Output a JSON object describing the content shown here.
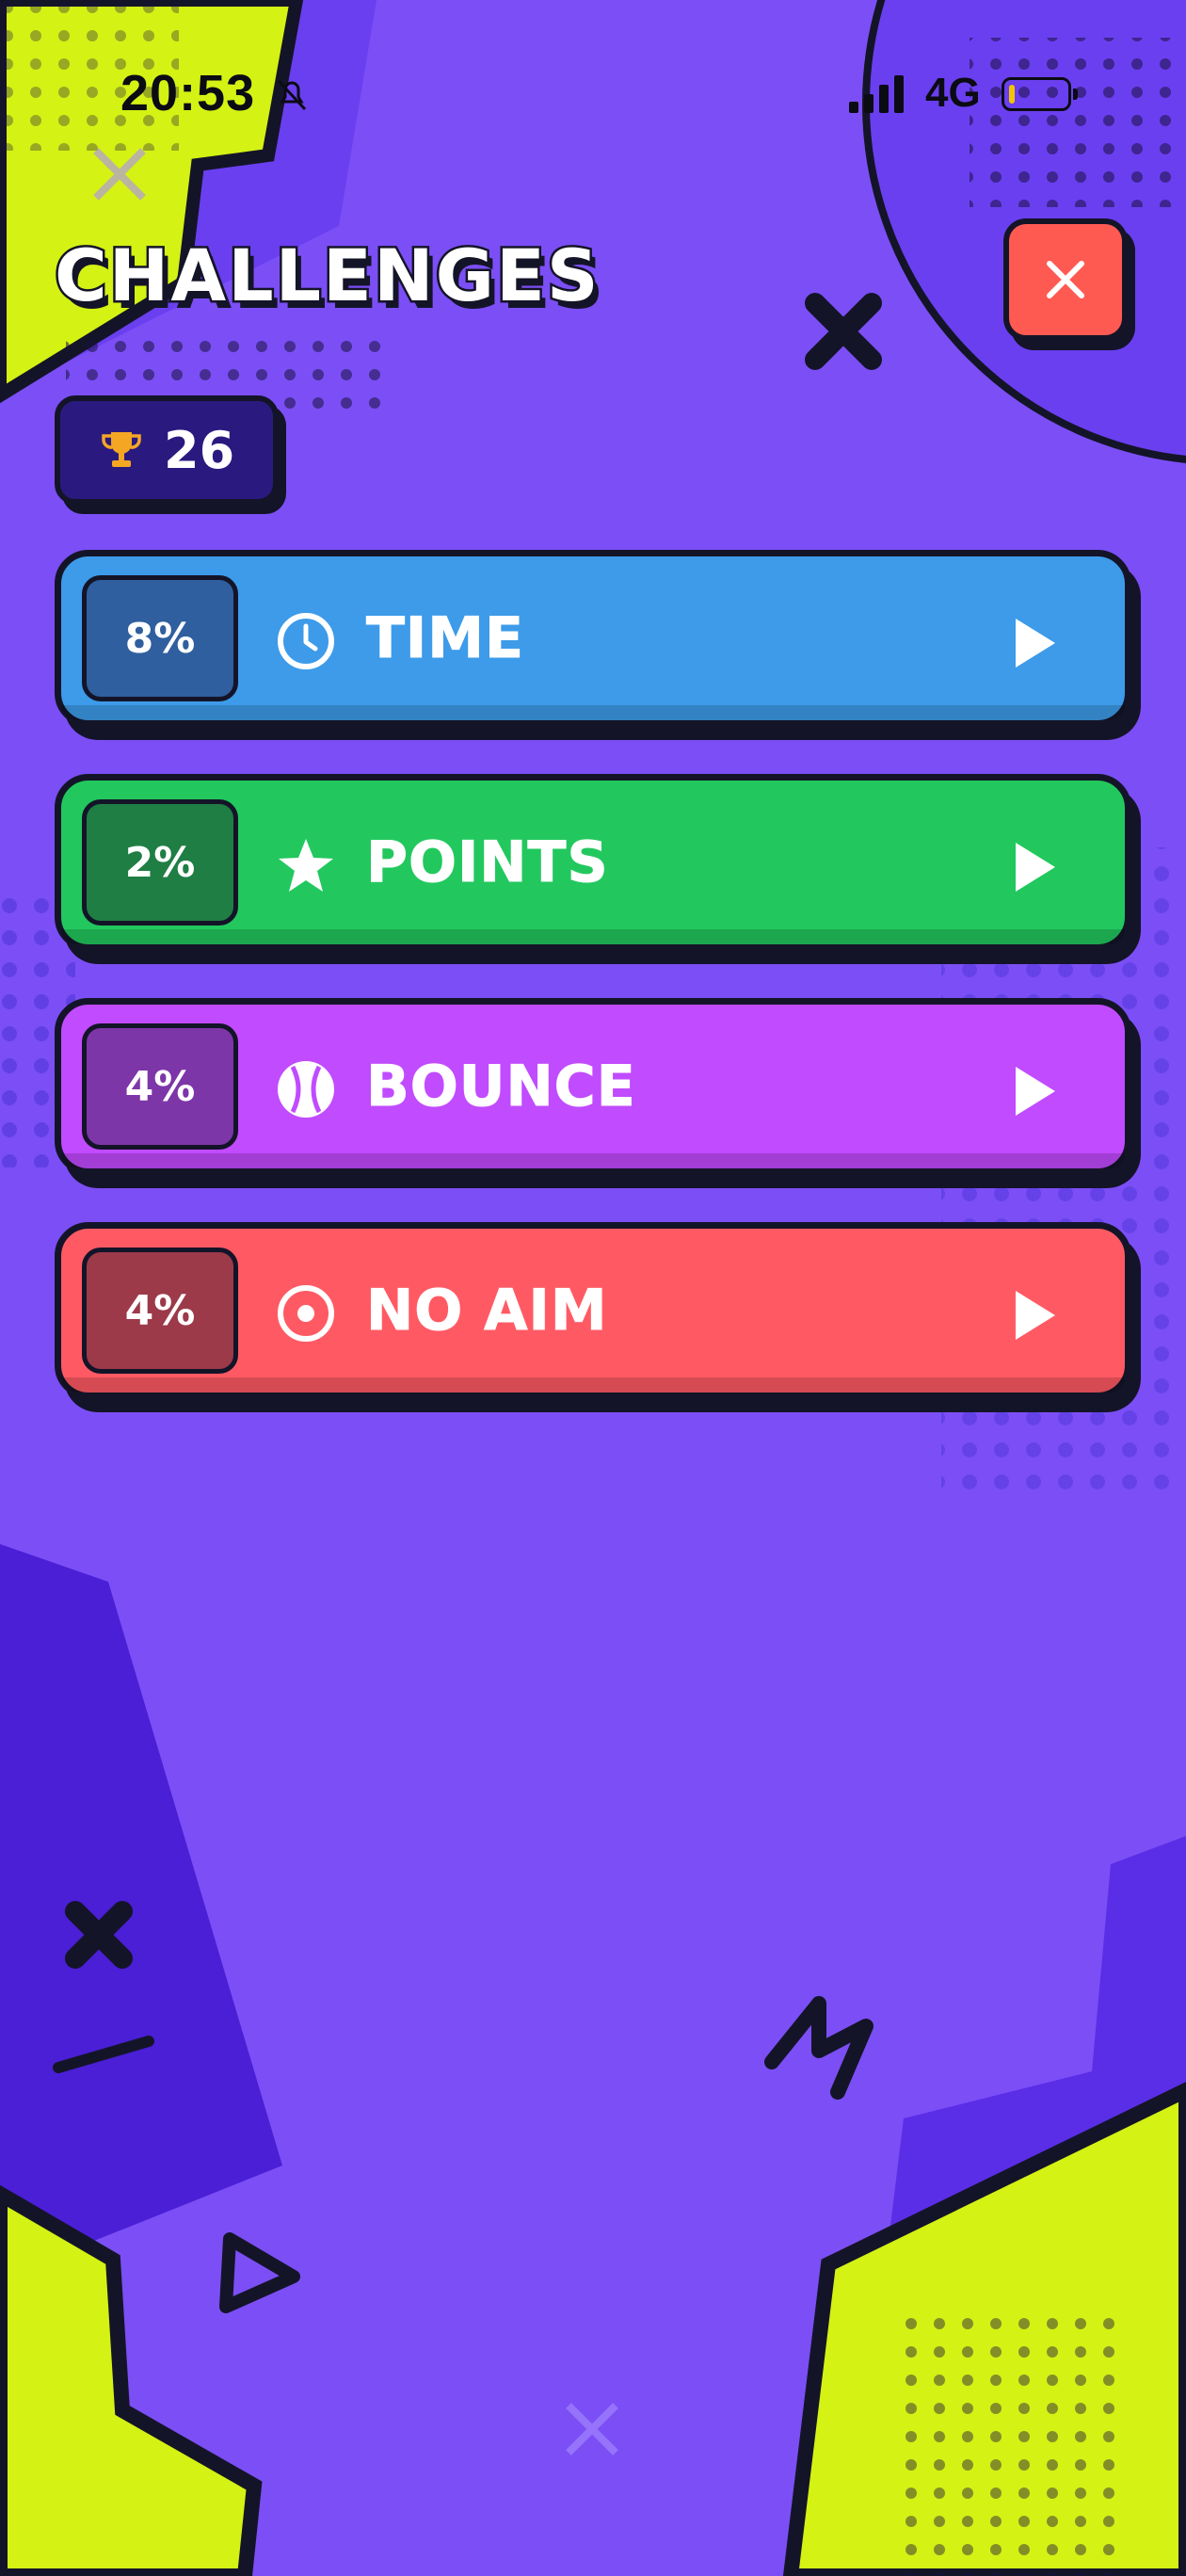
{
  "status_bar": {
    "time": "20:53",
    "network": "4G",
    "battery_level": 0.1
  },
  "title": "CHALLENGES",
  "close_button": {
    "icon": "close-icon"
  },
  "score": {
    "icon": "trophy-icon",
    "value": "26"
  },
  "challenges": [
    {
      "percent": "8%",
      "label": "TIME",
      "icon": "clock-icon",
      "color": "#3d9be9",
      "badge_color": "#2f5f9e"
    },
    {
      "percent": "2%",
      "label": "POINTS",
      "icon": "star-icon",
      "color": "#22c85e",
      "badge_color": "#1f7e44"
    },
    {
      "percent": "4%",
      "label": "BOUNCE",
      "icon": "ball-icon",
      "color": "#c14bff",
      "badge_color": "#7d36a8"
    },
    {
      "percent": "4%",
      "label": "NO AIM",
      "icon": "target-icon",
      "color": "#ff5a64",
      "badge_color": "#9c3a4a"
    }
  ],
  "colors": {
    "background": "#7b4ff5",
    "accent_lime": "#d4f214",
    "outline": "#141428"
  }
}
